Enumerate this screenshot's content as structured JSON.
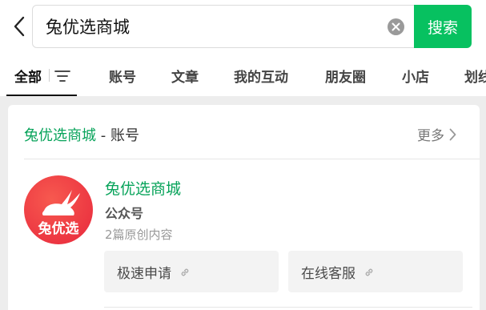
{
  "search": {
    "query": "兔优选商城",
    "button_label": "搜索"
  },
  "tabs": [
    {
      "label": "全部"
    },
    {
      "label": "账号"
    },
    {
      "label": "文章"
    },
    {
      "label": "我的互动"
    },
    {
      "label": "朋友圈"
    },
    {
      "label": "小店"
    },
    {
      "label": "划线"
    }
  ],
  "card": {
    "keyword": "兔优选商城",
    "header_suffix": " - 账号",
    "more_label": "更多",
    "account": {
      "logo_text": "兔优选",
      "name": "兔优选商城",
      "type": "公众号",
      "desc": "2篇原创内容"
    },
    "links": [
      {
        "label": "极速申请"
      },
      {
        "label": "在线客服"
      }
    ]
  },
  "colors": {
    "accent": "#07c160",
    "highlight_text": "#07a35a",
    "logo": "#e8283c"
  },
  "icons": [
    "back-arrow-icon",
    "clear-icon",
    "filter-icon",
    "chevron-right-icon",
    "link-icon",
    "rabbit-icon"
  ]
}
